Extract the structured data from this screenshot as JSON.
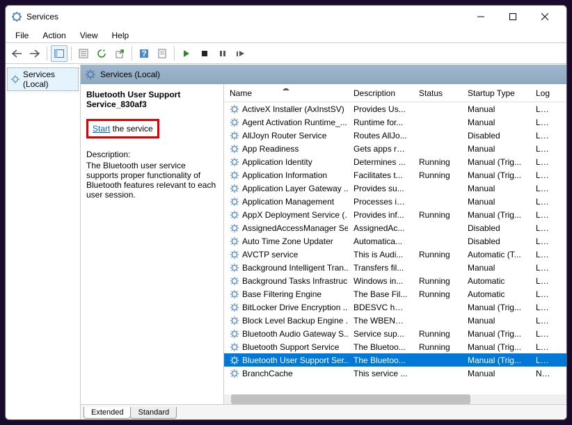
{
  "window": {
    "title": "Services"
  },
  "menu": {
    "file": "File",
    "action": "Action",
    "view": "View",
    "help": "Help"
  },
  "tree": {
    "root": "Services (Local)"
  },
  "right_header": "Services (Local)",
  "detail": {
    "name": "Bluetooth User Support Service_830af3",
    "start_link": "Start",
    "start_suffix": " the service",
    "desc_label": "Description:",
    "desc": "The Bluetooth user service supports proper functionality of Bluetooth features relevant to each user session."
  },
  "columns": {
    "name": "Name",
    "desc": "Description",
    "status": "Status",
    "startup": "Startup Type",
    "logon": "Log"
  },
  "tabs": {
    "extended": "Extended",
    "standard": "Standard"
  },
  "services": [
    {
      "name": "ActiveX Installer (AxInstSV)",
      "desc": "Provides Us...",
      "status": "",
      "startup": "Manual",
      "logon": "Loca"
    },
    {
      "name": "Agent Activation Runtime_...",
      "desc": "Runtime for...",
      "status": "",
      "startup": "Manual",
      "logon": "Loca"
    },
    {
      "name": "AllJoyn Router Service",
      "desc": "Routes AllJo...",
      "status": "",
      "startup": "Disabled",
      "logon": "Loca"
    },
    {
      "name": "App Readiness",
      "desc": "Gets apps re...",
      "status": "",
      "startup": "Manual",
      "logon": "Loca"
    },
    {
      "name": "Application Identity",
      "desc": "Determines ...",
      "status": "Running",
      "startup": "Manual (Trig...",
      "logon": "Loca"
    },
    {
      "name": "Application Information",
      "desc": "Facilitates t...",
      "status": "Running",
      "startup": "Manual (Trig...",
      "logon": "Loca"
    },
    {
      "name": "Application Layer Gateway ...",
      "desc": "Provides su...",
      "status": "",
      "startup": "Manual",
      "logon": "Loca"
    },
    {
      "name": "Application Management",
      "desc": "Processes in...",
      "status": "",
      "startup": "Manual",
      "logon": "Loca"
    },
    {
      "name": "AppX Deployment Service (...",
      "desc": "Provides inf...",
      "status": "Running",
      "startup": "Manual (Trig...",
      "logon": "Loca"
    },
    {
      "name": "AssignedAccessManager Se...",
      "desc": "AssignedAc...",
      "status": "",
      "startup": "Disabled",
      "logon": "Loca"
    },
    {
      "name": "Auto Time Zone Updater",
      "desc": "Automatica...",
      "status": "",
      "startup": "Disabled",
      "logon": "Loca"
    },
    {
      "name": "AVCTP service",
      "desc": "This is Audi...",
      "status": "Running",
      "startup": "Automatic (T...",
      "logon": "Loca"
    },
    {
      "name": "Background Intelligent Tran...",
      "desc": "Transfers fil...",
      "status": "",
      "startup": "Manual",
      "logon": "Loca"
    },
    {
      "name": "Background Tasks Infrastruc...",
      "desc": "Windows in...",
      "status": "Running",
      "startup": "Automatic",
      "logon": "Loca"
    },
    {
      "name": "Base Filtering Engine",
      "desc": "The Base Fil...",
      "status": "Running",
      "startup": "Automatic",
      "logon": "Loca"
    },
    {
      "name": "BitLocker Drive Encryption ...",
      "desc": "BDESVC hos...",
      "status": "",
      "startup": "Manual (Trig...",
      "logon": "Loca"
    },
    {
      "name": "Block Level Backup Engine ...",
      "desc": "The WBENG...",
      "status": "",
      "startup": "Manual",
      "logon": "Loca"
    },
    {
      "name": "Bluetooth Audio Gateway S...",
      "desc": "Service sup...",
      "status": "Running",
      "startup": "Manual (Trig...",
      "logon": "Loca"
    },
    {
      "name": "Bluetooth Support Service",
      "desc": "The Bluetoo...",
      "status": "Running",
      "startup": "Manual (Trig...",
      "logon": "Loca"
    },
    {
      "name": "Bluetooth User Support Ser...",
      "desc": "The Bluetoo...",
      "status": "",
      "startup": "Manual (Trig...",
      "logon": "Loca",
      "selected": true
    },
    {
      "name": "BranchCache",
      "desc": "This service ...",
      "status": "",
      "startup": "Manual",
      "logon": "Netv"
    }
  ]
}
